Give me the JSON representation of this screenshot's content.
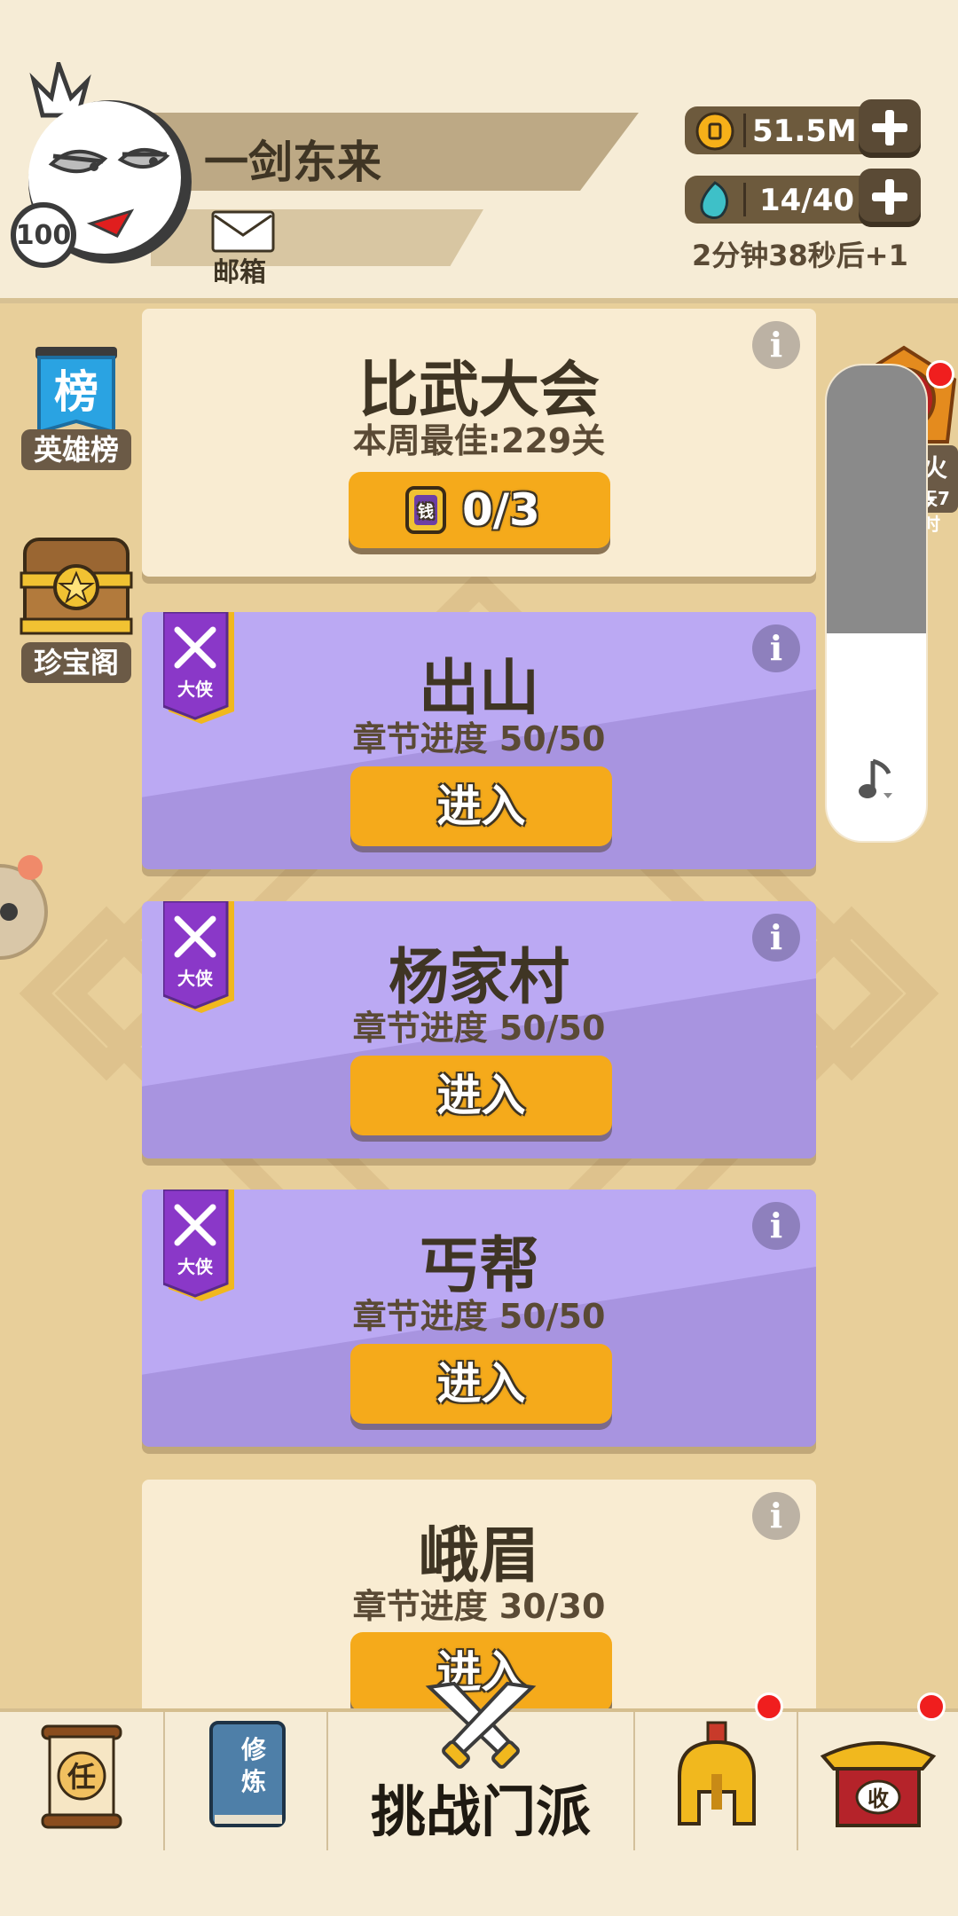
{
  "player": {
    "name": "一剑东来",
    "level": "100",
    "mail_label": "邮箱"
  },
  "resources": {
    "coins": "51.5M",
    "stamina": "14/40",
    "timer": "2分钟38秒后+1"
  },
  "side_left": {
    "leaderboard_glyph": "榜",
    "leaderboard_label": "英雄榜",
    "treasure_label": "珍宝阁"
  },
  "side_right": {
    "token_glyph": "令",
    "token_label": "圣火令",
    "token_time": "12天7小时"
  },
  "arena": {
    "title": "比武大会",
    "best": "本周最佳:229关",
    "ticket_glyph": "钱",
    "ticket_count": "0/3"
  },
  "chapters": [
    {
      "title": "出山",
      "progress": "章节进度 50/50",
      "button": "进入",
      "badge": "大侠"
    },
    {
      "title": "杨家村",
      "progress": "章节进度 50/50",
      "button": "进入",
      "badge": "大侠"
    },
    {
      "title": "丐帮",
      "progress": "章节进度 50/50",
      "button": "进入",
      "badge": "大侠"
    },
    {
      "title": "峨眉",
      "progress": "章节进度 30/30",
      "button": "进入"
    }
  ],
  "nav": {
    "quest_glyph": "任",
    "cultivate_glyph_1": "修",
    "cultivate_glyph_2": "炼",
    "center_label": "挑战门派",
    "shop_glyph": "收"
  },
  "colors": {
    "accent_button": "#f5aa1b",
    "card_purple": "#bba9f3",
    "card_cream": "#f9ecd2",
    "background": "#e8cf9a",
    "notification": "#f01e1e"
  }
}
